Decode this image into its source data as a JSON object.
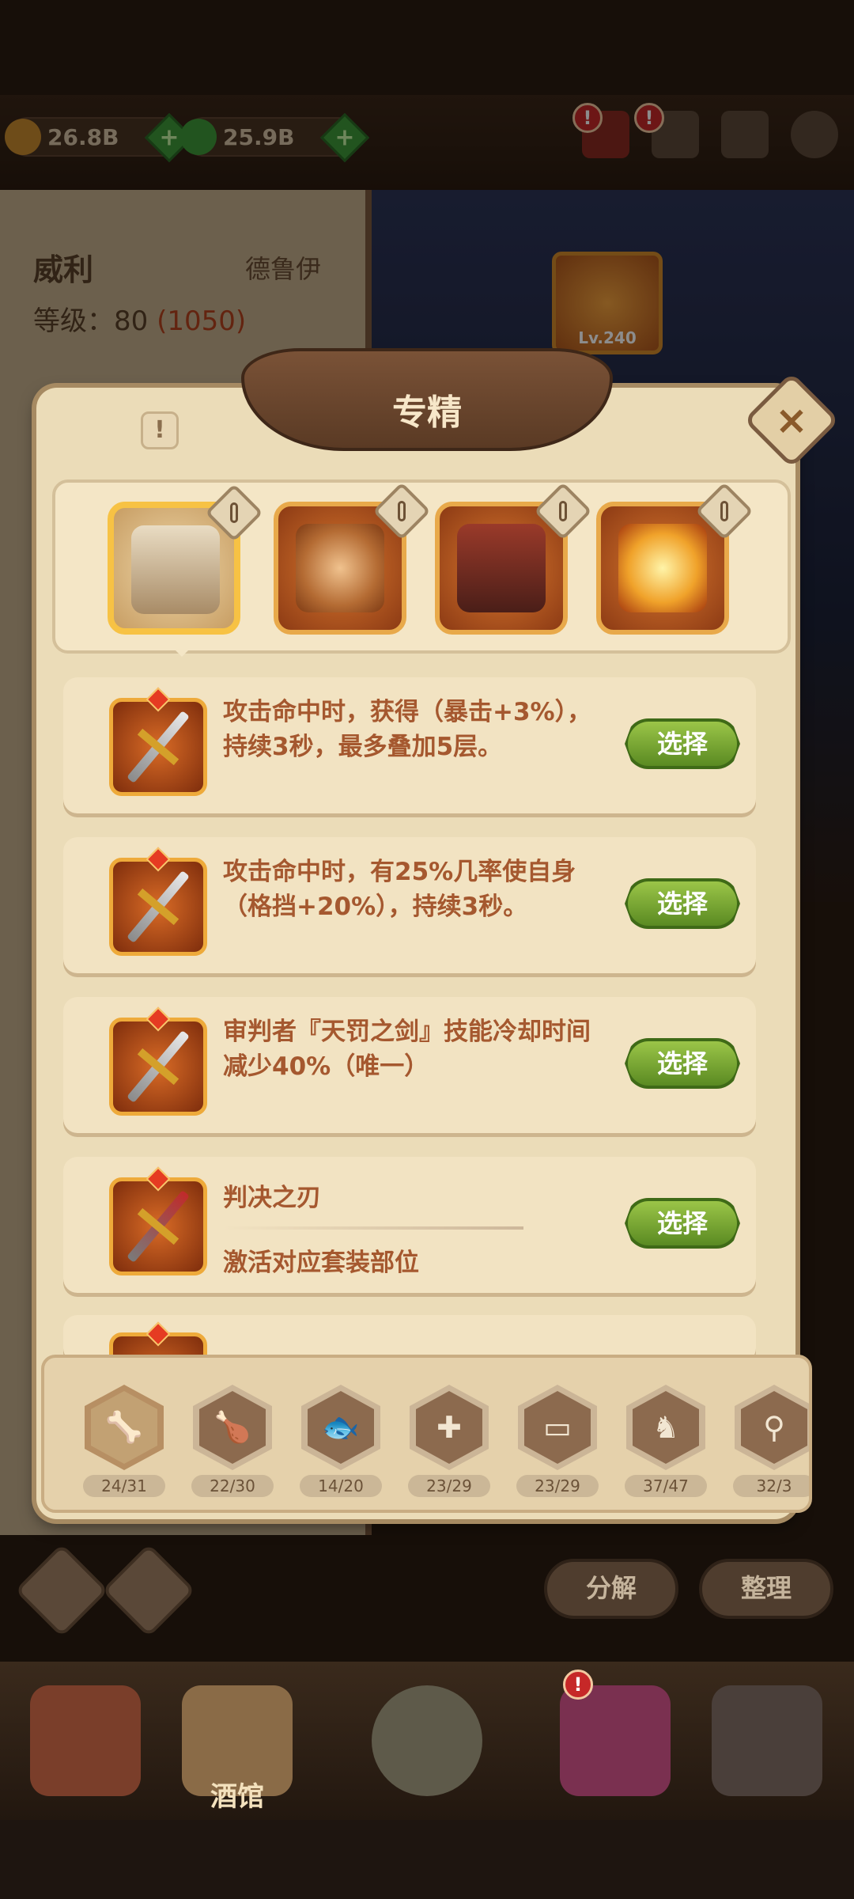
{
  "resources": [
    {
      "icon": "gold-coin-icon",
      "value": "26.8B",
      "color": "#c98a2e"
    },
    {
      "icon": "green-gem-icon",
      "value": "25.9B",
      "color": "#3f9a3a"
    }
  ],
  "hero": {
    "name": "威利",
    "class": "德鲁伊",
    "level_label": "等级：",
    "level": "80",
    "level_extra": "(1050)"
  },
  "frames": [
    {
      "level": "Lv.240"
    }
  ],
  "modal": {
    "title": "专精",
    "info": "!",
    "close": "×"
  },
  "slots": [
    {
      "name": "stone-pillar-icon",
      "selected": true
    },
    {
      "name": "amulet-icon",
      "selected": false
    },
    {
      "name": "armor-icon",
      "selected": false
    },
    {
      "name": "sun-burst-icon",
      "selected": false
    }
  ],
  "specializations": [
    {
      "type": "effect",
      "text": "攻击命中时，获得（暴击+3%），持续3秒，最多叠加5层。",
      "button": "选择"
    },
    {
      "type": "effect",
      "text": "攻击命中时，有25%几率使自身（格挡+20%），持续3秒。",
      "button": "选择"
    },
    {
      "type": "effect",
      "text": "审判者『天罚之剑』技能冷却时间减少40%（唯一）",
      "button": "选择"
    },
    {
      "type": "set",
      "name": "判决之刃",
      "desc": "激活对应套装部位",
      "button": "选择"
    }
  ],
  "categories": [
    {
      "glyph": "🦴",
      "count": "24/31",
      "active": true
    },
    {
      "glyph": "🍗",
      "count": "22/30",
      "active": false
    },
    {
      "glyph": "🐟",
      "count": "14/20",
      "active": false
    },
    {
      "glyph": "✚",
      "count": "23/29",
      "active": false
    },
    {
      "glyph": "▭",
      "count": "23/29",
      "active": false
    },
    {
      "glyph": "♞",
      "count": "37/47",
      "active": false
    },
    {
      "glyph": "⚲",
      "count": "32/3",
      "active": false
    }
  ],
  "actions": {
    "decompose": "分解",
    "sort": "整理"
  },
  "nav": [
    {
      "icon": "house-icon",
      "label": ""
    },
    {
      "icon": "tavern-mug-icon",
      "label": "酒馆"
    },
    {
      "icon": "portal-icon",
      "label": ""
    },
    {
      "icon": "treasure-icon",
      "label": ""
    },
    {
      "icon": "forge-icon",
      "label": ""
    }
  ]
}
